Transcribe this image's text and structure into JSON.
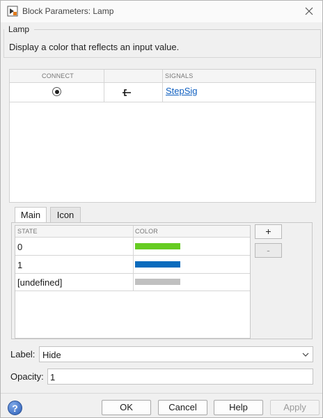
{
  "window": {
    "title": "Block Parameters: Lamp",
    "icon": "simulink-block-icon"
  },
  "group": {
    "label": "Lamp",
    "description": "Display a color that reflects an input value."
  },
  "signals": {
    "headers": {
      "connect": "CONNECT",
      "port": "",
      "signals": "SIGNALS"
    },
    "rows": [
      {
        "connected": true,
        "signal": "StepSig"
      }
    ]
  },
  "tabs": [
    {
      "label": "Main",
      "active": true
    },
    {
      "label": "Icon",
      "active": false
    }
  ],
  "states": {
    "headers": {
      "state": "STATE",
      "color": "COLOR"
    },
    "rows": [
      {
        "state": "0",
        "color": "#66cc22"
      },
      {
        "state": "1",
        "color": "#0a6bbd"
      },
      {
        "state": "[undefined]",
        "color": "#c0c0c0"
      }
    ],
    "add_label": "+",
    "remove_label": "-"
  },
  "label_field": {
    "label": "Label:",
    "value": "Hide"
  },
  "opacity_field": {
    "label": "Opacity:",
    "value": "1"
  },
  "buttons": {
    "ok": "OK",
    "cancel": "Cancel",
    "help": "Help",
    "apply": "Apply",
    "help_icon": "?"
  }
}
